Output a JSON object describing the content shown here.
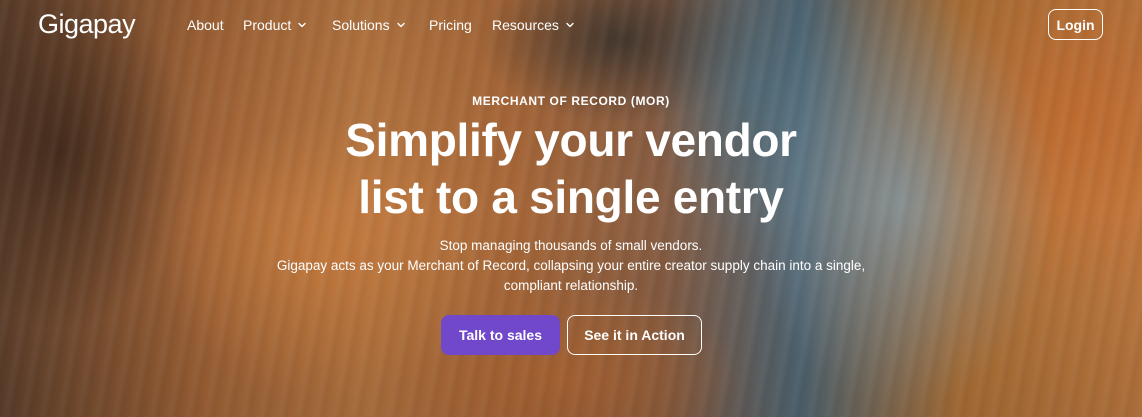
{
  "brand": {
    "logo_text": "Gigapay"
  },
  "nav": {
    "items": [
      {
        "label": "About",
        "has_dropdown": false
      },
      {
        "label": "Product",
        "has_dropdown": true
      },
      {
        "label": "Solutions",
        "has_dropdown": true
      },
      {
        "label": "Pricing",
        "has_dropdown": false
      },
      {
        "label": "Resources",
        "has_dropdown": true
      }
    ],
    "login_label": "Login"
  },
  "hero": {
    "eyebrow": "MERCHANT OF RECORD (MOR)",
    "headline_line1": "Simplify your vendor",
    "headline_line2": "list to a single entry",
    "sub_line1": "Stop managing thousands of small vendors.",
    "sub_line2": "Gigapay acts as your Merchant of Record, collapsing your entire creator supply chain into a single,",
    "sub_line3": "compliant relationship.",
    "primary_cta": "Talk to sales",
    "secondary_cta": "See it in Action"
  },
  "colors": {
    "accent": "#7048c9",
    "text": "#ffffff"
  },
  "icons": {
    "dropdown": "chevron-down-icon"
  }
}
